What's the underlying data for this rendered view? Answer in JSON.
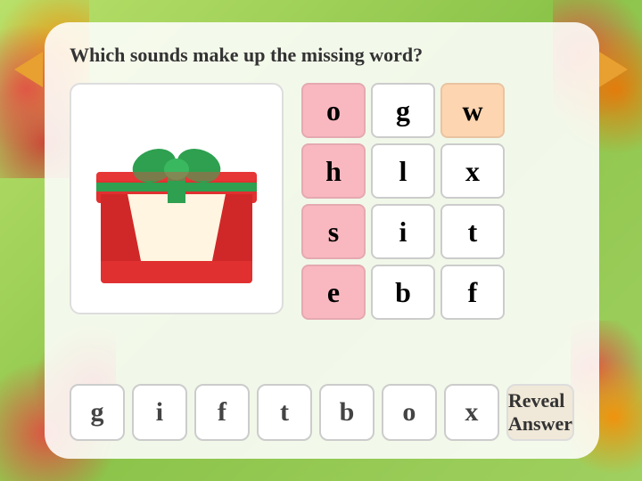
{
  "page": {
    "question": "Which sounds make up the missing word?",
    "nav_left_label": "←",
    "nav_right_label": "→"
  },
  "grid": {
    "rows": [
      [
        {
          "letter": "o",
          "bg": "pink-light"
        },
        {
          "letter": "g",
          "bg": "white"
        },
        {
          "letter": "w",
          "bg": "peach"
        }
      ],
      [
        {
          "letter": "h",
          "bg": "pink-light"
        },
        {
          "letter": "l",
          "bg": "white"
        },
        {
          "letter": "x",
          "bg": "white"
        }
      ],
      [
        {
          "letter": "s",
          "bg": "pink-light"
        },
        {
          "letter": "i",
          "bg": "white"
        },
        {
          "letter": "t",
          "bg": "white"
        }
      ],
      [
        {
          "letter": "e",
          "bg": "pink-light"
        },
        {
          "letter": "b",
          "bg": "white"
        },
        {
          "letter": "f",
          "bg": "white"
        }
      ]
    ]
  },
  "bottom_letters": [
    "g",
    "i",
    "f",
    "t",
    "b",
    "o",
    "x"
  ],
  "reveal_button": {
    "label": "Reveal Answer"
  }
}
